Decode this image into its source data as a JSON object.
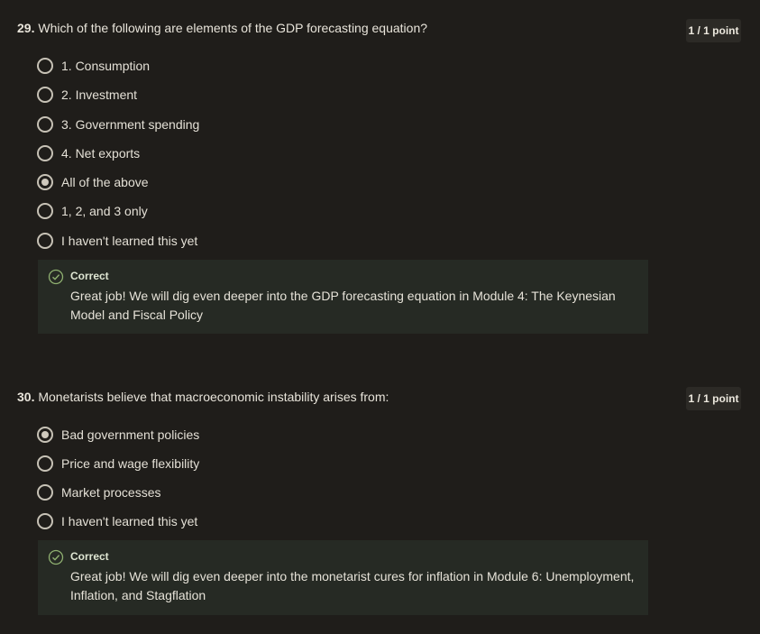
{
  "q29": {
    "number": "29.",
    "text": "Which of the following are elements of the GDP forecasting equation?",
    "points": "1 / 1 point",
    "options": [
      {
        "label": "1. Consumption",
        "checked": false
      },
      {
        "label": "2. Investment",
        "checked": false
      },
      {
        "label": "3. Government spending",
        "checked": false
      },
      {
        "label": "4. Net exports",
        "checked": false
      },
      {
        "label": "All of the above",
        "checked": true
      },
      {
        "label": "1, 2, and 3 only",
        "checked": false
      },
      {
        "label": "I haven't learned this yet",
        "checked": false
      }
    ],
    "feedback": {
      "title": "Correct",
      "text": "Great job! We will dig even deeper into the GDP forecasting equation in Module 4: The Keynesian Model and Fiscal Policy"
    }
  },
  "q30": {
    "number": "30.",
    "text": "Monetarists believe that macroeconomic instability arises from:",
    "points": "1 / 1 point",
    "options": [
      {
        "label": "Bad government policies",
        "checked": true
      },
      {
        "label": "Price and wage flexibility",
        "checked": false
      },
      {
        "label": "Market processes",
        "checked": false
      },
      {
        "label": "I haven't learned this yet",
        "checked": false
      }
    ],
    "feedback": {
      "title": "Correct",
      "text": "Great job! We will dig even deeper into the monetarist cures for inflation in Module 6: Unemployment, Inflation, and Stagflation"
    }
  },
  "colors": {
    "background": "#1f1d1a",
    "feedback_bg": "#262a24",
    "badge_bg": "#2c2a26",
    "check_green": "#8fb070"
  }
}
